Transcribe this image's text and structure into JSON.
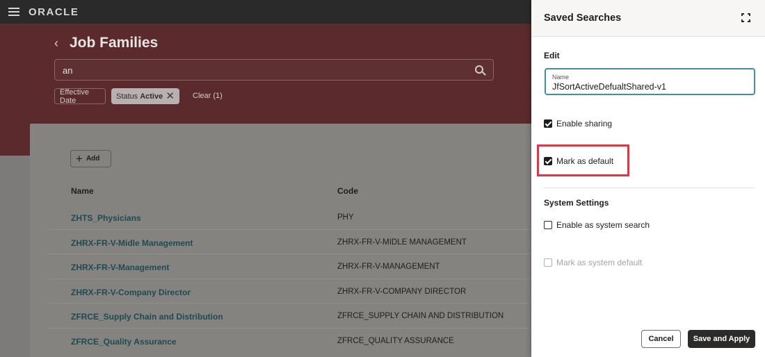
{
  "topbar": {
    "brand": "ORACLE"
  },
  "page": {
    "title": "Job Families",
    "search_value": "an",
    "filters": {
      "effective_date": "Effective Date",
      "status_label": "Status",
      "status_value": "Active",
      "clear": "Clear (1)"
    },
    "add_label": "Add",
    "table": {
      "columns": [
        "Name",
        "Code"
      ],
      "rows": [
        {
          "name": "ZHTS_Physicians",
          "code": "PHY"
        },
        {
          "name": "ZHRX-FR-V-Midle Management",
          "code": "ZHRX-FR-V-MIDLE MANAGEMENT"
        },
        {
          "name": "ZHRX-FR-V-Management",
          "code": "ZHRX-FR-V-MANAGEMENT"
        },
        {
          "name": "ZHRX-FR-V-Company Director",
          "code": "ZHRX-FR-V-COMPANY DIRECTOR"
        },
        {
          "name": "ZFRCE_Supply Chain and Distribution",
          "code": "ZFRCE_SUPPLY CHAIN AND DISTRIBUTION"
        },
        {
          "name": "ZFRCE_Quality Assurance",
          "code": "ZFRCE_QUALITY ASSURANCE"
        }
      ]
    }
  },
  "panel": {
    "title": "Saved Searches",
    "edit_section": "Edit",
    "name_label": "Name",
    "name_value": "JfSortActiveDefualtShared-v1",
    "enable_sharing": "Enable sharing",
    "mark_default": "Mark as default",
    "system_section": "System Settings",
    "enable_system": "Enable as system search",
    "mark_system_default": "Mark as system default",
    "cancel": "Cancel",
    "save": "Save and Apply"
  },
  "colors": {
    "highlight": "#e53345",
    "field_focus": "#3f8fa9",
    "primary_button": "#2c2b2a"
  }
}
